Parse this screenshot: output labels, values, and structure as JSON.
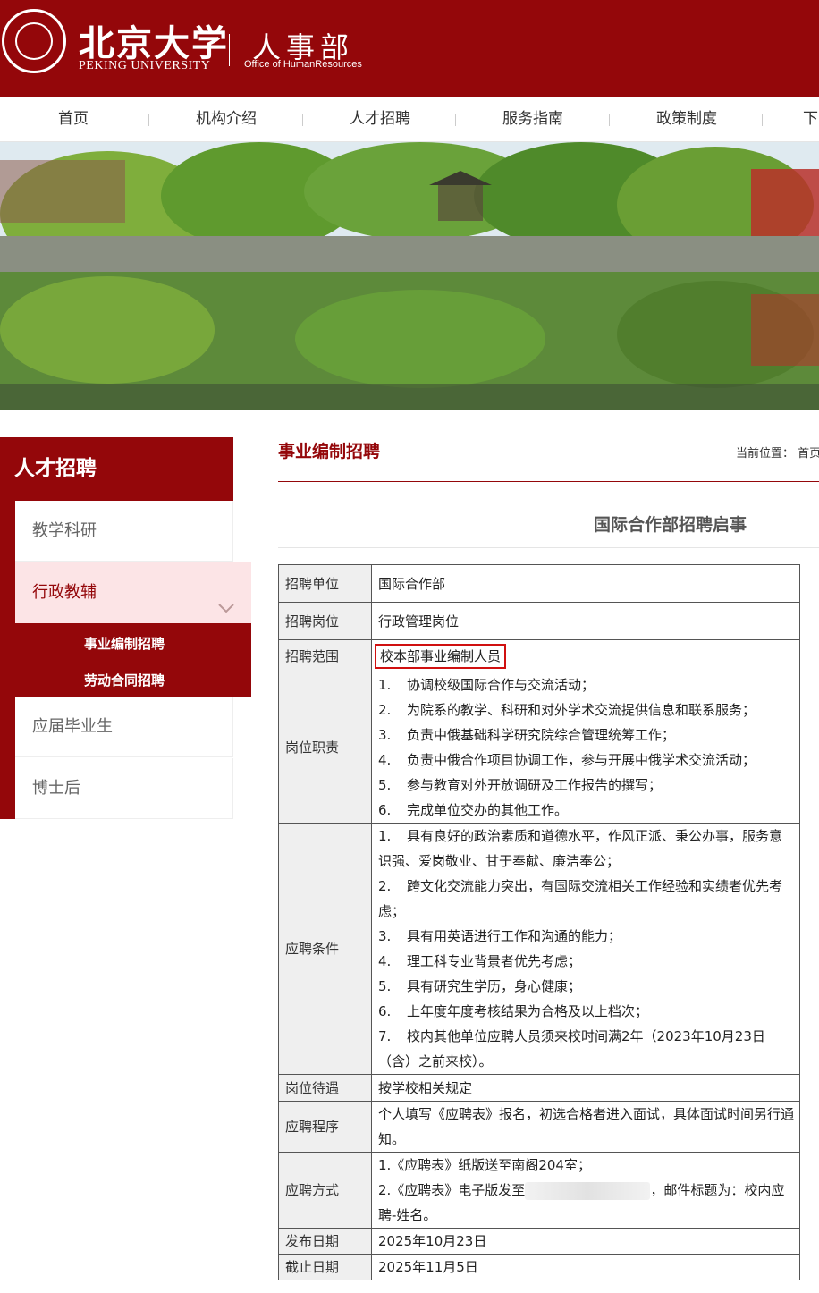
{
  "header": {
    "university_cn": "北京大学",
    "university_en": "PEKING UNIVERSITY",
    "seal_glyph": "北大",
    "dept_cn": "人事部",
    "dept_en": "Office of HumanResources",
    "brand_color": "#94070a"
  },
  "nav": [
    {
      "label": "首页"
    },
    {
      "label": "机构介绍"
    },
    {
      "label": "人才招聘"
    },
    {
      "label": "服务指南"
    },
    {
      "label": "政策制度"
    },
    {
      "label": "下"
    }
  ],
  "sidebar": {
    "title": "人才招聘",
    "items": [
      {
        "label": "教学科研"
      },
      {
        "label": "行政教辅",
        "active": true,
        "icon": "chevron-down-icon"
      },
      {
        "label": "应届毕业生"
      },
      {
        "label": "博士后"
      }
    ],
    "sub_items": [
      {
        "label": "事业编制招聘"
      },
      {
        "label": "劳动合同招聘"
      }
    ]
  },
  "main": {
    "section_title": "事业编制招聘",
    "breadcrumb": "当前位置： 首页",
    "article_title": "国际合作部招聘启事"
  },
  "table": {
    "unit_label": "招聘单位",
    "unit": "国际合作部",
    "post_label": "招聘岗位",
    "post": "行政管理岗位",
    "scope_label": "招聘范围",
    "scope": "校本部事业编制人员",
    "duties_label": "岗位职责",
    "duties": [
      {
        "n": "1.",
        "t": "协调校级国际合作与交流活动；"
      },
      {
        "n": "2.",
        "t": "为院系的教学、科研和对外学术交流提供信息和联系服务；"
      },
      {
        "n": "3.",
        "t": "负责中俄基础科学研究院综合管理统筹工作；"
      },
      {
        "n": "4.",
        "t": "负责中俄合作项目协调工作，参与开展中俄学术交流活动；"
      },
      {
        "n": "5.",
        "t": "参与教育对外开放调研及工作报告的撰写；"
      },
      {
        "n": "6.",
        "t": "完成单位交办的其他工作。"
      }
    ],
    "req_label": "应聘条件",
    "reqs": [
      {
        "n": "1.",
        "t": "具有良好的政治素质和道德水平，作风正派、秉公办事，服务意识强、爱岗敬业、甘于奉献、廉洁奉公；"
      },
      {
        "n": "2.",
        "t": "跨文化交流能力突出，有国际交流相关工作经验和实绩者优先考虑；"
      },
      {
        "n": "3.",
        "t": "具有用英语进行工作和沟通的能力；"
      },
      {
        "n": "4.",
        "t": "理工科专业背景者优先考虑；"
      },
      {
        "n": "5.",
        "t": "具有研究生学历，身心健康；"
      },
      {
        "n": "6.",
        "t": "上年度年度考核结果为合格及以上档次；"
      },
      {
        "n": "7.",
        "t": "校内其他单位应聘人员须来校时间满2年（2023年10月23日（含）之前来校）。"
      }
    ],
    "pay_label": "岗位待遇",
    "pay": "按学校相关规定",
    "proc_label": "应聘程序",
    "proc": "个人填写《应聘表》报名，初选合格者进入面试，具体面试时间另行通知。",
    "method_label": "应聘方式",
    "method1": "1.《应聘表》纸版送至南阁204室；",
    "method2_a": "2.《应聘表》电子版发至",
    "method2_b": "，邮件标题为：校内应聘-姓名。",
    "pub_label": "发布日期",
    "pub": "2025年10月23日",
    "due_label": "截止日期",
    "due": "2025年11月5日"
  }
}
